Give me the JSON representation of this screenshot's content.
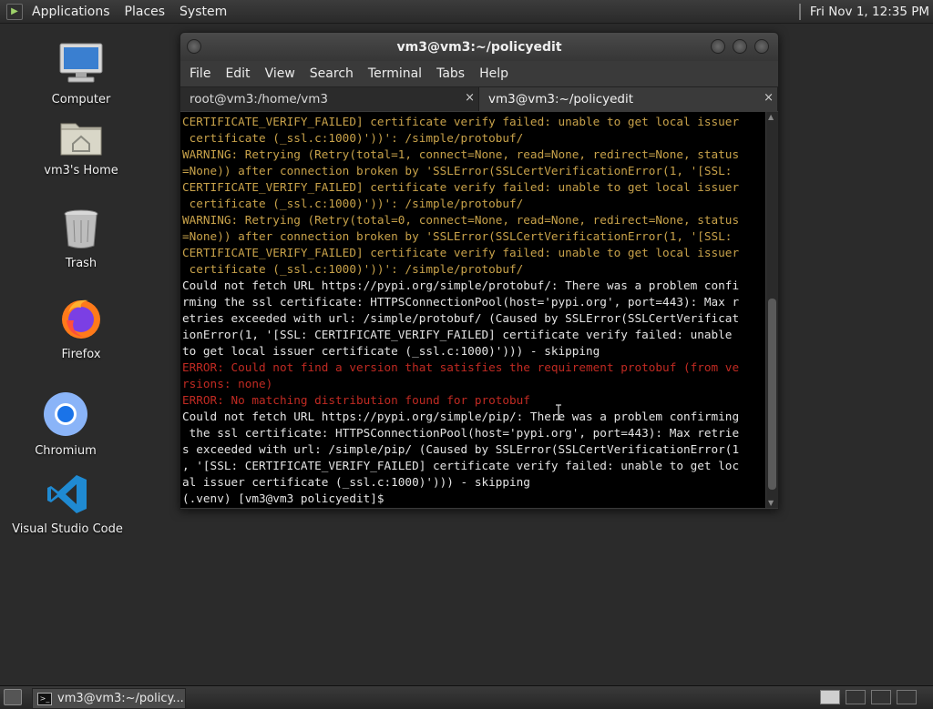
{
  "top_panel": {
    "menus": [
      "Applications",
      "Places",
      "System"
    ],
    "clock": "Fri Nov 1, 12:35 PM"
  },
  "desktop_icons": [
    {
      "label": "Computer",
      "icon": "computer-icon"
    },
    {
      "label": "vm3's Home",
      "icon": "home-folder-icon"
    },
    {
      "label": "Trash",
      "icon": "trash-icon"
    },
    {
      "label": "Firefox",
      "icon": "firefox-icon"
    },
    {
      "label": "Chromium",
      "icon": "chromium-icon"
    },
    {
      "label": "Visual Studio Code",
      "icon": "vscode-icon"
    }
  ],
  "window": {
    "title": "vm3@vm3:~/policyedit",
    "menu": [
      "File",
      "Edit",
      "View",
      "Search",
      "Terminal",
      "Tabs",
      "Help"
    ],
    "tabs": [
      {
        "label": "root@vm3:/home/vm3",
        "active": false
      },
      {
        "label": "vm3@vm3:~/policyedit",
        "active": true
      }
    ],
    "close_glyph": "×"
  },
  "terminal_lines": [
    {
      "style": "warn",
      "text": "CERTIFICATE_VERIFY_FAILED] certificate verify failed: unable to get local issuer"
    },
    {
      "style": "warn",
      "text": " certificate (_ssl.c:1000)'))': /simple/protobuf/"
    },
    {
      "style": "warn",
      "text": "WARNING: Retrying (Retry(total=1, connect=None, read=None, redirect=None, status"
    },
    {
      "style": "warn",
      "text": "=None)) after connection broken by 'SSLError(SSLCertVerificationError(1, '[SSL:"
    },
    {
      "style": "warn",
      "text": "CERTIFICATE_VERIFY_FAILED] certificate verify failed: unable to get local issuer"
    },
    {
      "style": "warn",
      "text": " certificate (_ssl.c:1000)'))': /simple/protobuf/"
    },
    {
      "style": "warn",
      "text": "WARNING: Retrying (Retry(total=0, connect=None, read=None, redirect=None, status"
    },
    {
      "style": "warn",
      "text": "=None)) after connection broken by 'SSLError(SSLCertVerificationError(1, '[SSL:"
    },
    {
      "style": "warn",
      "text": "CERTIFICATE_VERIFY_FAILED] certificate verify failed: unable to get local issuer"
    },
    {
      "style": "warn",
      "text": " certificate (_ssl.c:1000)'))': /simple/protobuf/"
    },
    {
      "style": "norm",
      "text": "Could not fetch URL https://pypi.org/simple/protobuf/: There was a problem confi"
    },
    {
      "style": "norm",
      "text": "rming the ssl certificate: HTTPSConnectionPool(host='pypi.org', port=443): Max r"
    },
    {
      "style": "norm",
      "text": "etries exceeded with url: /simple/protobuf/ (Caused by SSLError(SSLCertVerificat"
    },
    {
      "style": "norm",
      "text": "ionError(1, '[SSL: CERTIFICATE_VERIFY_FAILED] certificate verify failed: unable"
    },
    {
      "style": "norm",
      "text": "to get local issuer certificate (_ssl.c:1000)'))) - skipping"
    },
    {
      "style": "err",
      "text": "ERROR: Could not find a version that satisfies the requirement protobuf (from ve"
    },
    {
      "style": "err",
      "text": "rsions: none)"
    },
    {
      "style": "err",
      "text": "ERROR: No matching distribution found for protobuf"
    },
    {
      "style": "norm",
      "text": "Could not fetch URL https://pypi.org/simple/pip/: There was a problem confirming"
    },
    {
      "style": "norm",
      "text": " the ssl certificate: HTTPSConnectionPool(host='pypi.org', port=443): Max retrie"
    },
    {
      "style": "norm",
      "text": "s exceeded with url: /simple/pip/ (Caused by SSLError(SSLCertVerificationError(1"
    },
    {
      "style": "norm",
      "text": ", '[SSL: CERTIFICATE_VERIFY_FAILED] certificate verify failed: unable to get loc"
    },
    {
      "style": "norm",
      "text": "al issuer certificate (_ssl.c:1000)'))) - skipping"
    },
    {
      "style": "norm",
      "text": "(.venv) [vm3@vm3 policyedit]$"
    }
  ],
  "bottom_panel": {
    "task_label": "vm3@vm3:~/policy..."
  },
  "colors": {
    "warning_text": "#c8a24a",
    "error_text": "#c02a22",
    "terminal_bg": "#000000"
  }
}
